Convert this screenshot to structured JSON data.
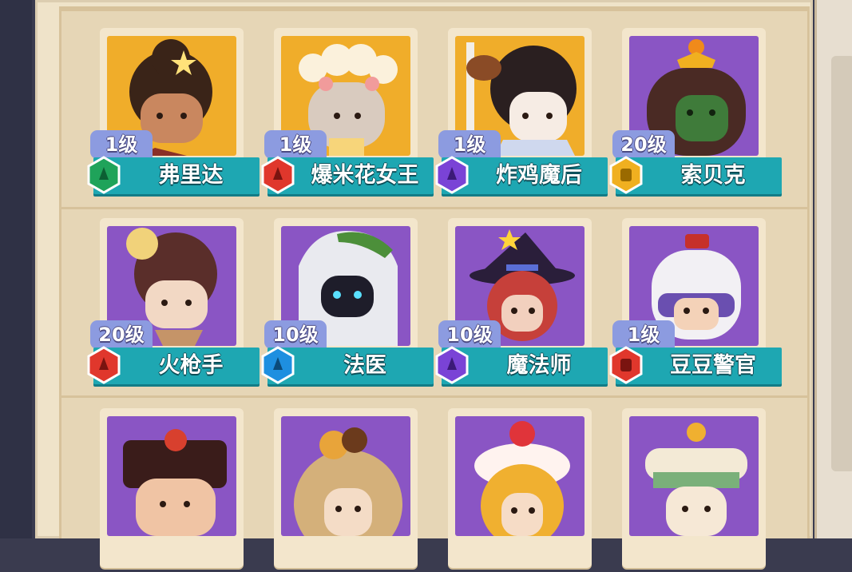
{
  "characters": [
    {
      "level": "1级",
      "name": "弗里达",
      "rarity": "green",
      "bg": "gold"
    },
    {
      "level": "1级",
      "name": "爆米花女王",
      "rarity": "red",
      "bg": "gold"
    },
    {
      "level": "1级",
      "name": "炸鸡魔后",
      "rarity": "purple",
      "bg": "gold"
    },
    {
      "level": "20级",
      "name": "索贝克",
      "rarity": "gold",
      "bg": "purple"
    },
    {
      "level": "20级",
      "name": "火枪手",
      "rarity": "red",
      "bg": "purple"
    },
    {
      "level": "10级",
      "name": "法医",
      "rarity": "blue",
      "bg": "purple"
    },
    {
      "level": "10级",
      "name": "魔法师",
      "rarity": "purple",
      "bg": "purple"
    },
    {
      "level": "1级",
      "name": "豆豆警官",
      "rarity": "red",
      "bg": "purple"
    }
  ],
  "rarity_colors": {
    "green": "#1fa35a",
    "red": "#e0372c",
    "purple": "#7a43d6",
    "gold": "#f0b020",
    "blue": "#1e8fe0"
  },
  "icon_names": {
    "rarity": "hexagon-badge-icon"
  }
}
